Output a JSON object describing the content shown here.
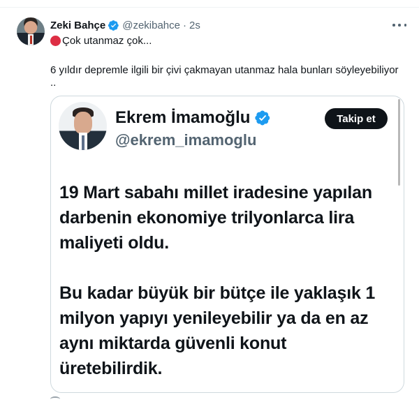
{
  "tweet": {
    "author_name": "Zeki Bahçe",
    "author_handle": "@zekibahce",
    "separator": "·",
    "time": "2s",
    "text_line1": "Çok utanmaz çok...",
    "text_line2": "6 yıldır depremle ilgili bir çivi çakmayan utanmaz hala bunları söyleyebiliyor",
    "text_line3": ".."
  },
  "quoted": {
    "name": "Ekrem İmamoğlu",
    "handle": "@ekrem_imamoglu",
    "follow_label": "Takip et",
    "paragraph1": [
      "19 Mart sabahı millet iradesine yapılan",
      "darbenin ekonomiye trilyonlarca lira",
      "maliyeti oldu."
    ],
    "paragraph2": [
      "Bu kadar büyük bir bütçe ile yaklaşık 1",
      "milyon yapıyı yenileyebilir ya da en az",
      "aynı miktarda güvenli konut",
      "üretebilirdik."
    ]
  },
  "icons": {
    "verified": "verified-badge-icon",
    "more": "more-icon",
    "emoji": "red-circle-icon"
  },
  "colors": {
    "verified_blue": "#1d9bf0",
    "text_primary": "#0f1419",
    "text_secondary": "#536471",
    "emoji_red": "#dd2e44",
    "border": "#cfd9de"
  }
}
